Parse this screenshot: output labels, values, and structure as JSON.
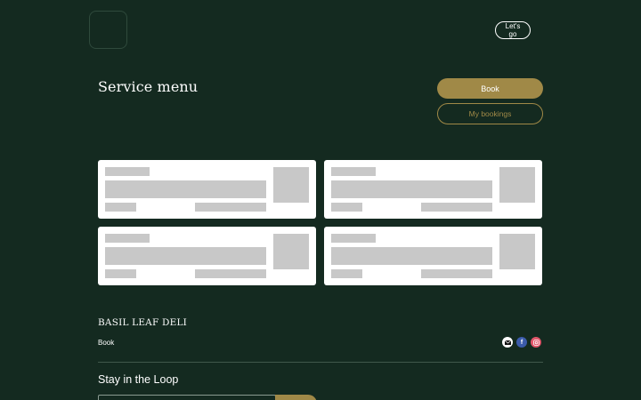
{
  "header": {
    "cta_label": "Let's go"
  },
  "main": {
    "title": "Service menu",
    "book_label": "Book",
    "my_bookings_label": "My bookings",
    "service_cards_loading": 4
  },
  "footer": {
    "brand": "BASIL LEAF DELI",
    "book_link": "Book",
    "social_icons": [
      "mail-icon",
      "facebook-icon",
      "instagram-icon"
    ],
    "newsletter_title": "Stay in the Loop"
  },
  "colors": {
    "background": "#142a20",
    "accent": "#a08947",
    "card": "#ffffff",
    "skeleton": "#c8c8c8"
  }
}
